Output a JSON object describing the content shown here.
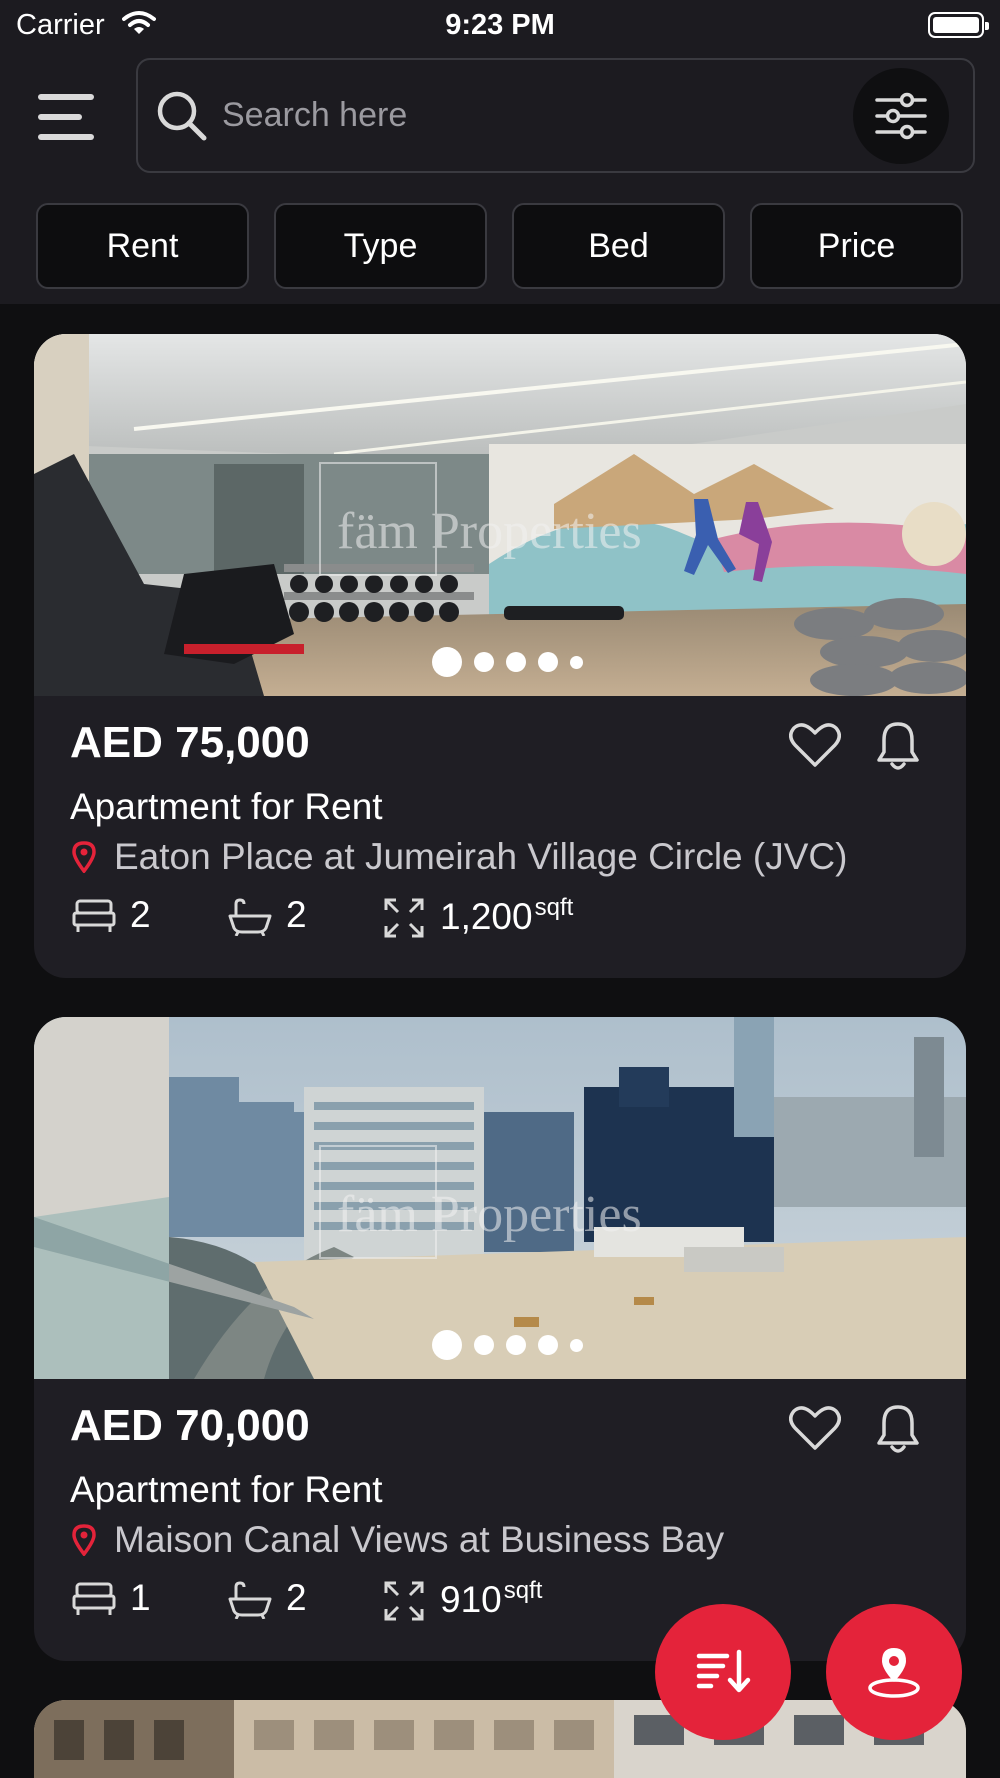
{
  "status_bar": {
    "carrier": "Carrier",
    "time": "9:23 PM"
  },
  "search": {
    "placeholder": "Search here"
  },
  "filters": [
    "Rent",
    "Type",
    "Bed",
    "Price"
  ],
  "listings": [
    {
      "price": "AED 75,000",
      "type": "Apartment for Rent",
      "location": "Eaton Place at Jumeirah Village Circle (JVC)",
      "beds": "2",
      "baths": "2",
      "area": "1,200",
      "area_unit": "sqft",
      "watermark": "fäm Properties",
      "image_count": 5,
      "active_image": 1
    },
    {
      "price": "AED 70,000",
      "type": "Apartment for Rent",
      "location": "Maison Canal Views at Business Bay",
      "beds": "1",
      "baths": "2",
      "area": "910",
      "area_unit": "sqft",
      "watermark": "fäm Properties",
      "image_count": 5,
      "active_image": 1
    }
  ],
  "icons": {
    "menu": "hamburger-icon",
    "search": "search-icon",
    "filter": "sliders-icon",
    "favorite": "heart-icon",
    "notify": "bell-icon",
    "location": "pin-icon",
    "bed": "bed-icon",
    "bath": "bathtub-icon",
    "area": "expand-icon",
    "sort": "sort-icon",
    "map": "map-pin-icon"
  },
  "colors": {
    "accent": "#e4233a",
    "background": "#0f0f11",
    "surface": "#1f1e24",
    "header": "#1c1b20"
  }
}
